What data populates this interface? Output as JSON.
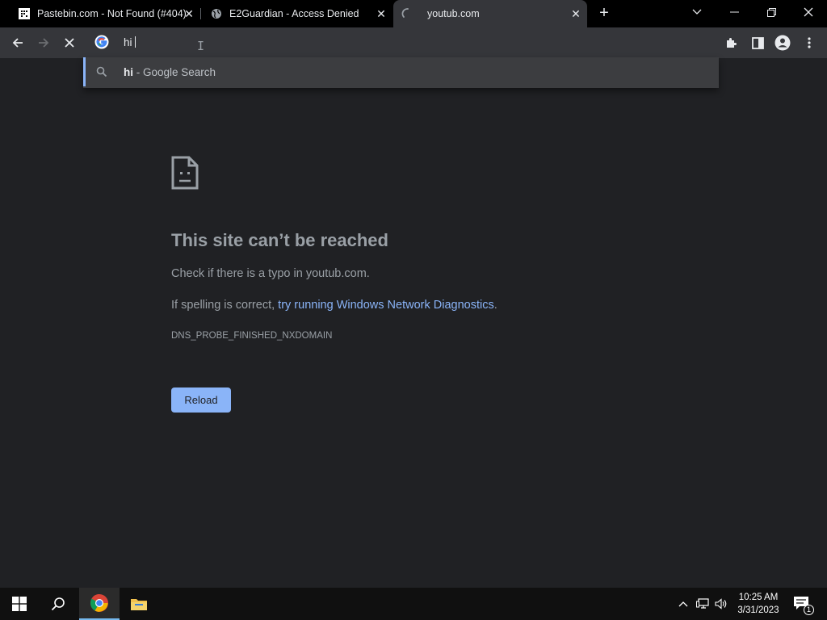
{
  "tabs": [
    {
      "title": "Pastebin.com - Not Found (#404)",
      "favicon": "pastebin-icon",
      "active": false
    },
    {
      "title": "E2Guardian - Access Denied",
      "favicon": "globe-icon",
      "active": false
    },
    {
      "title": "youtub.com",
      "favicon": "loading-spinner-icon",
      "active": true
    }
  ],
  "omnibox": {
    "value": "hi",
    "suggestion_query": "hi",
    "suggestion_suffix": " - Google Search"
  },
  "error": {
    "title": "This site can’t be reached",
    "line1": "Check if there is a typo in youtub.com.",
    "line2_prefix": "If spelling is correct, ",
    "line2_link": "try running Windows Network Diagnostics",
    "line2_suffix": ".",
    "code": "DNS_PROBE_FINISHED_NXDOMAIN",
    "reload_label": "Reload"
  },
  "taskbar": {
    "time": "10:25 AM",
    "date": "3/31/2023",
    "notification_count": "1"
  },
  "colors": {
    "page_bg": "#202124",
    "toolbar_bg": "#35363a",
    "accent": "#8ab4f8",
    "taskbar_bg": "#101010"
  }
}
